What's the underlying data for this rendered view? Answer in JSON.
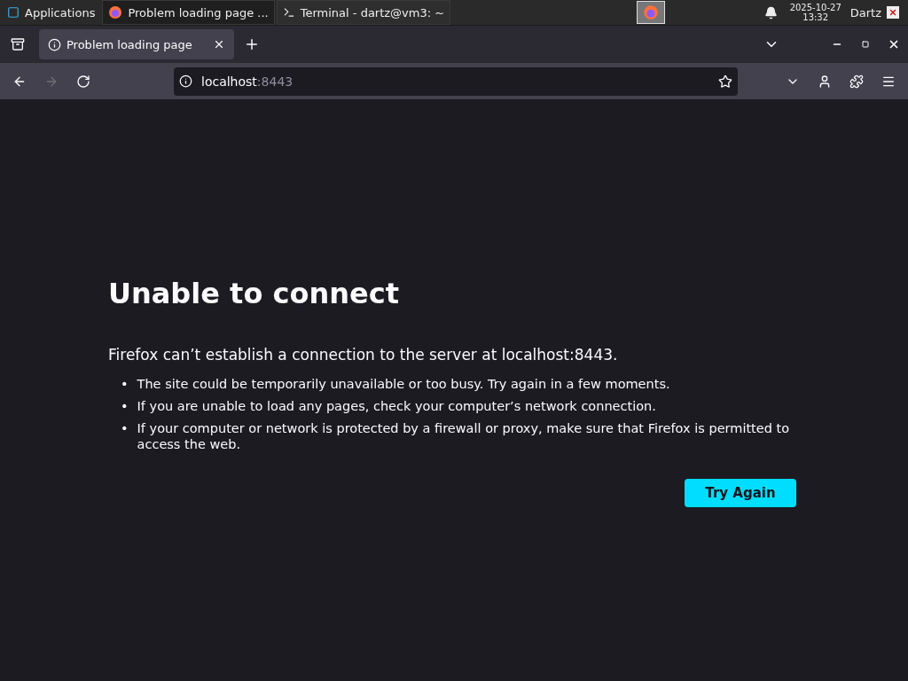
{
  "taskbar": {
    "menu_label": "Applications",
    "windows": [
      {
        "title": "Problem loading page ...",
        "kind": "browser",
        "selected": true
      },
      {
        "title": "Terminal - dartz@vm3: ~",
        "kind": "terminal",
        "selected": false
      }
    ],
    "date": "2025-10-27",
    "time": "13:32",
    "user": "Dartz"
  },
  "tabs": [
    {
      "title": "Problem loading page",
      "selected": true
    }
  ],
  "nav": {
    "back_disabled": false,
    "forward_disabled": true
  },
  "url": {
    "host": "localhost",
    "port": ":8443"
  },
  "error": {
    "title": "Unable to connect",
    "message": "Firefox can’t establish a connection to the server at localhost:8443.",
    "tips": [
      {
        "bullet": "•",
        "text": "The site could be temporarily unavailable or too busy. Try again in a few moments."
      },
      {
        "bullet": "•",
        "text": "If you are unable to load any pages, check your computer’s network connection."
      },
      {
        "bullet": "•",
        "text": "If your computer or network is protected by a firewall or proxy, make sure that Firefox is permitted to access the web."
      }
    ],
    "button": "Try Again"
  }
}
